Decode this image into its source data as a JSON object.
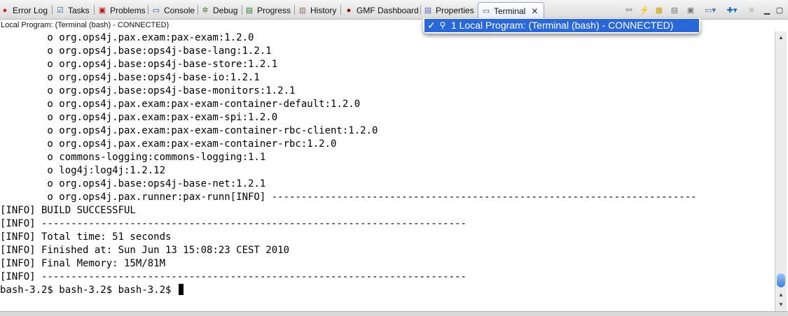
{
  "tabs": [
    {
      "label": "Error Log",
      "icon": "error-log-icon"
    },
    {
      "label": "Tasks",
      "icon": "tasks-icon"
    },
    {
      "label": "Problems",
      "icon": "problems-icon"
    },
    {
      "label": "Console",
      "icon": "console-icon"
    },
    {
      "label": "Debug",
      "icon": "debug-icon"
    },
    {
      "label": "Progress",
      "icon": "progress-icon"
    },
    {
      "label": "History",
      "icon": "history-icon"
    },
    {
      "label": "GMF Dashboard",
      "icon": "gmf-dashboard-icon"
    },
    {
      "label": "Properties",
      "icon": "properties-icon"
    },
    {
      "label": "Terminal",
      "icon": "terminal-icon",
      "active": true
    }
  ],
  "status_line": "Local Program: (Terminal (bash) - CONNECTED)",
  "popup": {
    "item": "1 Local Program: (Terminal (bash) - CONNECTED)",
    "checked": true
  },
  "terminal": {
    "lines": [
      "        o org.ops4j.pax.exam:pax-exam:1.2.0",
      "        o org.ops4j.base:ops4j-base-lang:1.2.1",
      "        o org.ops4j.base:ops4j-base-store:1.2.1",
      "        o org.ops4j.base:ops4j-base-io:1.2.1",
      "        o org.ops4j.base:ops4j-base-monitors:1.2.1",
      "        o org.ops4j.pax.exam:pax-exam-container-default:1.2.0",
      "        o org.ops4j.pax.exam:pax-exam-spi:1.2.0",
      "        o org.ops4j.pax.exam:pax-exam-container-rbc-client:1.2.0",
      "        o org.ops4j.pax.exam:pax-exam-container-rbc:1.2.0",
      "        o commons-logging:commons-logging:1.1",
      "        o log4j:log4j:1.2.12",
      "        o org.ops4j.base:ops4j-base-net:1.2.1",
      "        o org.ops4j.pax.runner:pax-runn[INFO] ------------------------------------------------------------------------",
      "[INFO] BUILD SUCCESSFUL",
      "[INFO] ------------------------------------------------------------------------",
      "[INFO] Total time: 51 seconds",
      "[INFO] Finished at: Sun Jun 13 15:08:23 CEST 2010",
      "[INFO] Final Memory: 15M/81M",
      "[INFO] ------------------------------------------------------------------------"
    ],
    "prompt": "bash-3.2$ bash-3.2$ bash-3.2$ "
  },
  "toolbar": [
    "disconnect-icon",
    "connect-icon",
    "settings-icon",
    "scroll-lock-icon",
    "pin-icon",
    "display-selected-terminal-icon",
    "open-terminal-icon",
    "remove-terminal-icon",
    "minimize-icon",
    "maximize-icon"
  ],
  "colors": {
    "selection": "#2a68d8",
    "scroll_thumb": "#3d7ed6"
  }
}
